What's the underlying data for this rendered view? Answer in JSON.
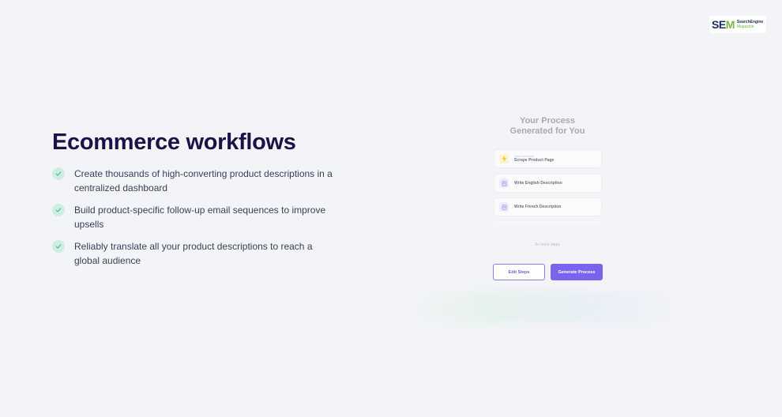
{
  "logo": {
    "main_se": "SE",
    "main_m": "M",
    "sub_line1": "SearchEngine",
    "sub_line2": "Magazine"
  },
  "heading": "Ecommerce workflows",
  "features": [
    {
      "icon": "check-icon",
      "text": "Create thousands of high-converting product descriptions in a centralized dashboard"
    },
    {
      "icon": "check-icon",
      "text": "Build product-specific follow-up email sequences to improve upsells"
    },
    {
      "icon": "check-icon",
      "text": "Reliably translate all your product descriptions to reach a global audience"
    }
  ],
  "process": {
    "title_line1": "Your Process",
    "title_line2": "Generated for You",
    "steps": [
      {
        "icon": "bolt-icon",
        "caption": "Input Command",
        "label": "Scrape Product Page"
      },
      {
        "icon": "document-icon",
        "caption": "",
        "label": "Write English Description"
      },
      {
        "icon": "document-icon",
        "caption": "",
        "label": "Write French Description"
      }
    ],
    "more_steps": "3+ more steps",
    "edit_button": "Edit Steps",
    "generate_button": "Generate Process"
  },
  "colors": {
    "background": "#f3f4f7",
    "heading": "#1b1246",
    "check_bg": "#cfeee2",
    "check_mark": "#3fbf8f",
    "accent": "#7b63ee",
    "logo_navy": "#1d2c57",
    "logo_green": "#74b843"
  }
}
